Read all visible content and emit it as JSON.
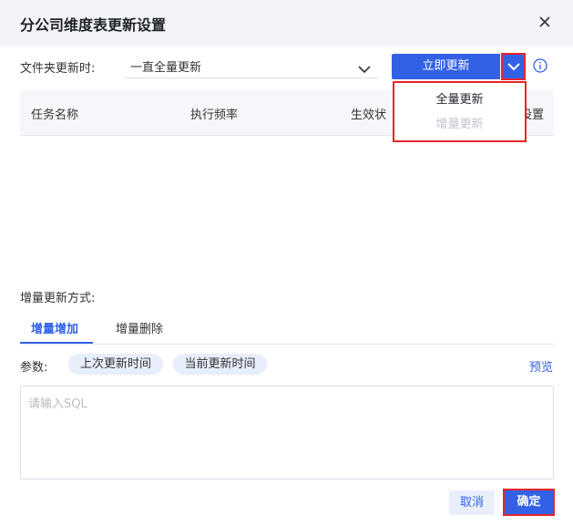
{
  "dialog": {
    "title": "分公司维度表更新设置"
  },
  "folder_update": {
    "label": "文件夹更新时:",
    "selected": "一直全量更新",
    "update_now_label": "立即更新"
  },
  "dropdown_menu": {
    "items": [
      {
        "label": "全量更新",
        "enabled": true
      },
      {
        "label": "增量更新",
        "enabled": false
      }
    ]
  },
  "table": {
    "columns": [
      "任务名称",
      "执行频率",
      "生效状",
      "设置"
    ]
  },
  "incremental": {
    "label": "增量更新方式:",
    "tabs": [
      {
        "label": "增量增加",
        "active": true
      },
      {
        "label": "增量删除",
        "active": false
      }
    ],
    "params_label": "参数:",
    "params": [
      "上次更新时间",
      "当前更新时间"
    ],
    "preview_label": "预览",
    "sql_placeholder": "请输入SQL"
  },
  "footer": {
    "cancel_label": "取消",
    "ok_label": "确定"
  },
  "colors": {
    "primary": "#3361e6",
    "highlight_border": "#e8262a",
    "chip_bg": "#e8eefc",
    "header_bg": "#f2f4f7"
  }
}
